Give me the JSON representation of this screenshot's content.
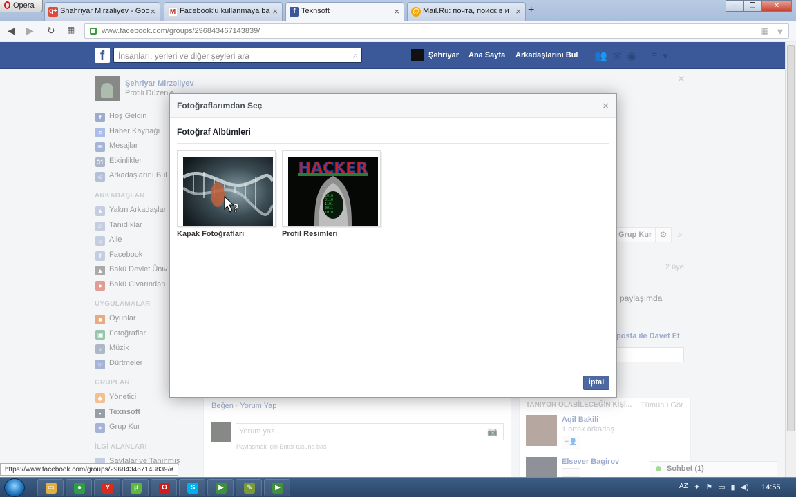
{
  "browser": {
    "opera_label": "Opera",
    "tabs": [
      {
        "label": "Shahriyar Mirzaliyev - Goo",
        "icon": "google-plus-icon",
        "color": "#dd4b39"
      },
      {
        "label": "Facebook'u kullanmaya ba",
        "icon": "gmail-icon",
        "color": "#c5221f"
      },
      {
        "label": "Texnsoft",
        "icon": "facebook-icon",
        "color": "#3b5998"
      },
      {
        "label": "Mail.Ru: почта, поиск в и",
        "icon": "mailru-icon",
        "color": "#f2a400"
      }
    ],
    "new_tab": "+",
    "url": "www.facebook.com/groups/296843467143839/",
    "window_buttons": [
      "–",
      "❐",
      "✕"
    ]
  },
  "fb_header": {
    "logo": "f",
    "search_placeholder": "İnsanları, yerleri ve diğer şeyleri ara",
    "user_name": "Şehriyar",
    "home": "Ana Sayfa",
    "find_friends": "Arkadaşlarını Bul"
  },
  "sidebar": {
    "profile_name": "Şehriyar Mirzəliyev",
    "profile_sub": "Profili Düzenle",
    "items_top": [
      {
        "label": "Hoş Geldin",
        "icon": "facebook-icon",
        "color": "#3b5998",
        "glyph": "f"
      },
      {
        "label": "Haber Kaynağı",
        "icon": "news-feed-icon",
        "color": "#5b7bd5",
        "glyph": "≡"
      },
      {
        "label": "Mesajlar",
        "icon": "messages-icon",
        "color": "#4a67ad",
        "glyph": "✉"
      },
      {
        "label": "Etkinlikler",
        "icon": "events-icon",
        "color": "#5d6f8e",
        "glyph": "31"
      },
      {
        "label": "Arkadaşlarını Bul",
        "icon": "find-friends-icon",
        "color": "#6a7fb0",
        "glyph": "☺"
      }
    ],
    "friends_head": "ARKADAŞLAR",
    "friends": [
      {
        "label": "Yakın Arkadaşlar",
        "icon": "close-friends-icon",
        "color": "#8b9dc3",
        "glyph": "★"
      },
      {
        "label": "Tanıdıklar",
        "icon": "acquaintances-icon",
        "color": "#8b9dc3",
        "glyph": "☺"
      },
      {
        "label": "Aile",
        "icon": "family-icon",
        "color": "#8b9dc3",
        "glyph": "⌂"
      },
      {
        "label": "Facebook",
        "icon": "facebook-list-icon",
        "color": "#8b9dc3",
        "glyph": "f"
      },
      {
        "label": "Bakü Devlet Üniv",
        "icon": "graduation-icon",
        "color": "#555",
        "glyph": "▲"
      },
      {
        "label": "Bakü Civarından",
        "icon": "location-pin-icon",
        "color": "#c0392b",
        "glyph": "●"
      }
    ],
    "apps_head": "UYGULAMALAR",
    "apps": [
      {
        "label": "Oyunlar",
        "icon": "games-icon",
        "color": "#d35400",
        "glyph": "■"
      },
      {
        "label": "Fotoğraflar",
        "icon": "photos-icon",
        "color": "#2e8b57",
        "glyph": "▣"
      },
      {
        "label": "Müzik",
        "icon": "music-icon",
        "color": "#5d6f8e",
        "glyph": "♪"
      },
      {
        "label": "Dürtmeler",
        "icon": "pokes-icon",
        "color": "#4a67ad",
        "glyph": "☞"
      }
    ],
    "groups_head": "GRUPLAR",
    "groups": [
      {
        "label": "Yönetici",
        "icon": "admin-group-icon",
        "color": "#e67e22",
        "glyph": "◆",
        "bold": false
      },
      {
        "label": "Texnsoft",
        "icon": "group-icon",
        "color": "#2c3e50",
        "glyph": "▪",
        "bold": true
      },
      {
        "label": "Grup Kur",
        "icon": "create-group-icon",
        "color": "#4a67ad",
        "glyph": "+",
        "bold": false
      }
    ],
    "interests_head": "İLGİ ALANLARI",
    "interests_item": "Sayfalar ve Tanınmış"
  },
  "group_page": {
    "create_group": "Grup Kur",
    "members": "2 üye",
    "share_text": "paylaşımda",
    "invite_text": "posta ile Davet Et",
    "feed_like": "Beğen",
    "feed_comment": "Yorum Yap",
    "comment_placeholder": "Yorum yaz...",
    "comment_hint": "Paylaşmak için Enter tuşuna bas",
    "pymk_head": "TANIYOR OLABİLECEĞİN KİŞİ...",
    "pymk_all": "Tümünü Gör",
    "people": [
      {
        "name": "Aqil Bakili",
        "mutual": "1 ortak arkadaş"
      },
      {
        "name": "Elsever Bagirov",
        "mutual": ""
      }
    ],
    "chat": "Sohbet (1)"
  },
  "modal": {
    "title": "Fotoğraflarımdan Seç",
    "subtitle": "Fotoğraf Albümleri",
    "albums": [
      {
        "label": "Kapak Fotoğrafları",
        "kind": "dna-cover"
      },
      {
        "label": "Profil Resimleri",
        "kind": "hacker",
        "overlay_text": "HACKER"
      }
    ],
    "cancel": "İptal"
  },
  "status_url": "https://www.facebook.com/groups/296843467143839/#",
  "taskbar": {
    "items": [
      {
        "icon": "explorer-icon",
        "color": "#e0b040",
        "glyph": "▭"
      },
      {
        "icon": "chrome-icon",
        "color": "#2e9e46",
        "glyph": "●"
      },
      {
        "icon": "yandex-icon",
        "color": "#d62d20",
        "glyph": "Y"
      },
      {
        "icon": "utorrent-icon",
        "color": "#5bb83b",
        "glyph": "µ"
      },
      {
        "icon": "opera-icon",
        "color": "#d21c1c",
        "glyph": "O"
      },
      {
        "icon": "skype-icon",
        "color": "#00aff0",
        "glyph": "S"
      },
      {
        "icon": "camtasia-icon",
        "color": "#3f8f3f",
        "glyph": "▶"
      },
      {
        "icon": "notepad-icon",
        "color": "#7a9a3a",
        "glyph": "✎"
      },
      {
        "icon": "recorder-icon",
        "color": "#3f8f3f",
        "glyph": "▶"
      }
    ],
    "lang": "AZ",
    "time": "14:55"
  }
}
